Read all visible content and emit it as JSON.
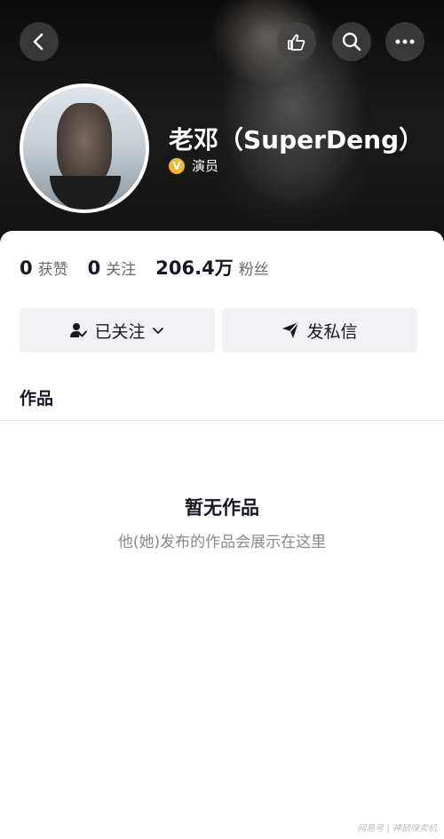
{
  "header": {
    "icons": {
      "back": "chevron-left-icon",
      "recommend": "pointing-hand-icon",
      "search": "search-icon",
      "more": "more-icon"
    }
  },
  "profile": {
    "name": "老邓（SuperDeng）",
    "verified_badge": "V",
    "verified_label": "演员",
    "badge_color": "#f1b62a"
  },
  "stats": [
    {
      "value": "0",
      "label": "获赞"
    },
    {
      "value": "0",
      "label": "关注"
    },
    {
      "value": "206.4万",
      "label": "粉丝"
    }
  ],
  "actions": {
    "follow_label": "已关注",
    "message_label": "发私信"
  },
  "tabs": {
    "works": "作品"
  },
  "empty_state": {
    "title": "暂无作品",
    "subtitle": "他(她)发布的作品会展示在这里"
  },
  "watermark": "网易号 | 神鼠嗅卖机"
}
